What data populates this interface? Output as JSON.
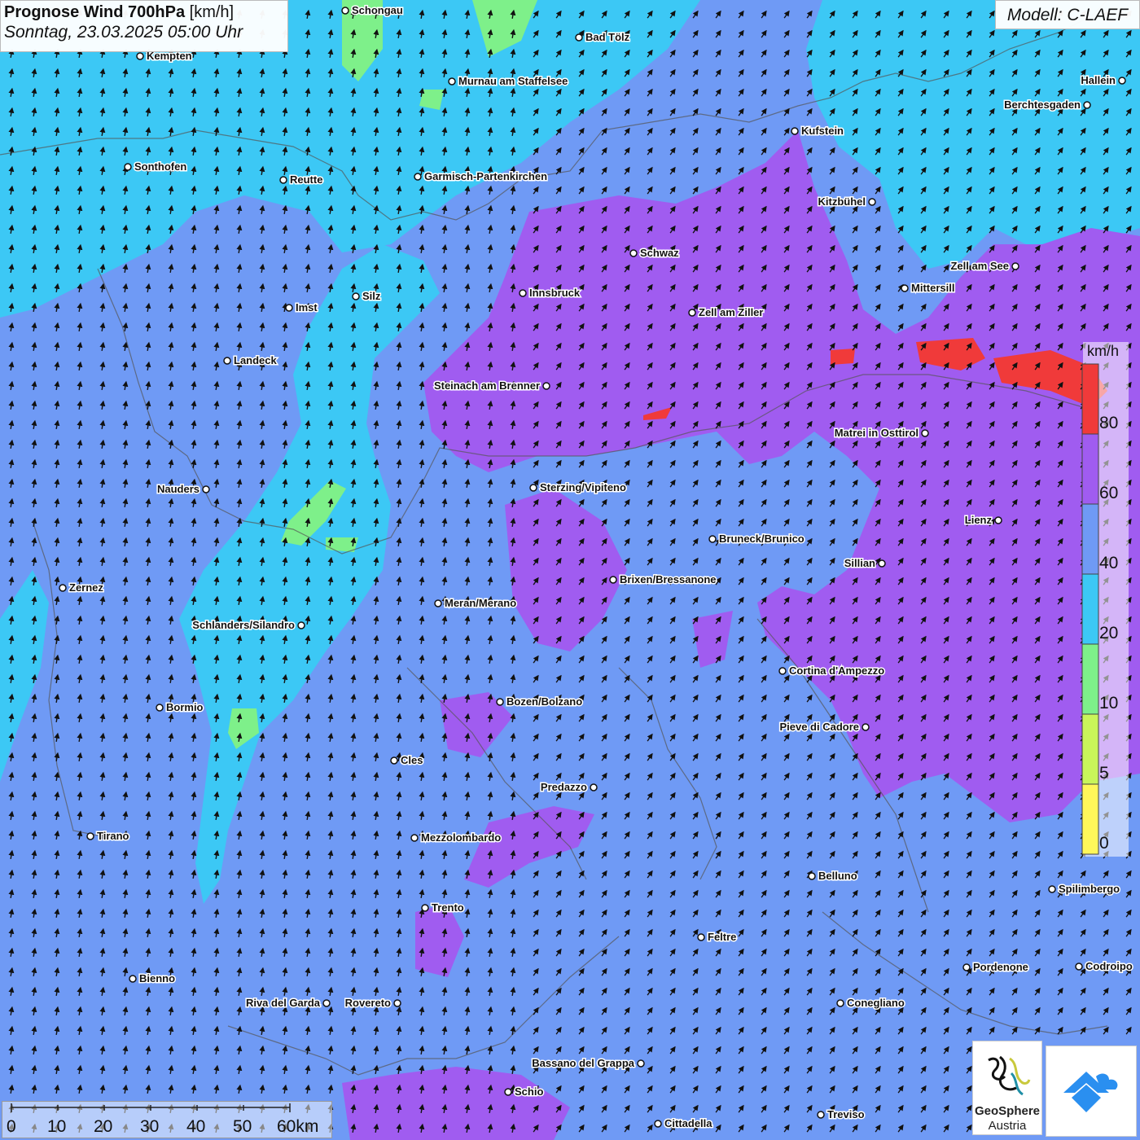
{
  "title": {
    "main": "Prognose Wind 700hPa",
    "unit": "[km/h]",
    "datetime": "Sonntag, 23.03.2025 05:00 Uhr"
  },
  "model": "Modell: C-LAEF",
  "legend": {
    "unit": "km/h",
    "labels": [
      "80",
      "60",
      "40",
      "20",
      "10",
      "5",
      "0"
    ],
    "colors": [
      "#f03a3a",
      "#a05cf0",
      "#6f9af5",
      "#3cc8f5",
      "#7ef08a",
      "#c9f55a",
      "#fff75a"
    ]
  },
  "scale_bar": {
    "labels": [
      "0",
      "10",
      "20",
      "30",
      "40",
      "50",
      "60km"
    ]
  },
  "logos": {
    "geosphere_name": "GeoSphere",
    "geosphere_sub": "Austria",
    "app_icon": "wind-app-icon",
    "geosphere_icon": "geosphere-logo-icon"
  },
  "map_colors": {
    "base": "#6f9af5",
    "cyan": "#3cc8f5",
    "purple": "#a05cf0",
    "green": "#7ef08a",
    "red": "#f03a3a"
  },
  "wind_direction": "from southwest / south",
  "cities": [
    {
      "name": "Schongau"
    },
    {
      "name": "Bad Tölz"
    },
    {
      "name": "Kempten"
    },
    {
      "name": "Murnau am Staffelsee"
    },
    {
      "name": "Hallein"
    },
    {
      "name": "Berchtesgaden"
    },
    {
      "name": "Kufstein"
    },
    {
      "name": "Sonthofen"
    },
    {
      "name": "Reutte"
    },
    {
      "name": "Garmisch-Partenkirchen"
    },
    {
      "name": "Kitzbühel"
    },
    {
      "name": "Schwaz"
    },
    {
      "name": "Zell am See"
    },
    {
      "name": "Mittersill"
    },
    {
      "name": "Innsbruck"
    },
    {
      "name": "Silz"
    },
    {
      "name": "Imst"
    },
    {
      "name": "Zell am Ziller"
    },
    {
      "name": "Landeck"
    },
    {
      "name": "Steinach am Brenner"
    },
    {
      "name": "Matrei in Osttirol"
    },
    {
      "name": "Nauders"
    },
    {
      "name": "Sterzing/Vipiteno"
    },
    {
      "name": "Lienz"
    },
    {
      "name": "Bruneck/Brunico"
    },
    {
      "name": "Sillian"
    },
    {
      "name": "Brixen/Bressanone"
    },
    {
      "name": "Zernez"
    },
    {
      "name": "Meran/Merano"
    },
    {
      "name": "Schlanders/Silandro"
    },
    {
      "name": "Cortina d'Ampezzo"
    },
    {
      "name": "Bozen/Bolzano"
    },
    {
      "name": "Bormio"
    },
    {
      "name": "Pieve di Cadore"
    },
    {
      "name": "Cles"
    },
    {
      "name": "Predazzo"
    },
    {
      "name": "Tirano"
    },
    {
      "name": "Mezzolombardo"
    },
    {
      "name": "Belluno"
    },
    {
      "name": "Spilimbergo"
    },
    {
      "name": "Trento"
    },
    {
      "name": "Feltre"
    },
    {
      "name": "Pordenone"
    },
    {
      "name": "Codroipo"
    },
    {
      "name": "Bienno"
    },
    {
      "name": "Riva del Garda"
    },
    {
      "name": "Rovereto"
    },
    {
      "name": "Conegliano"
    },
    {
      "name": "Bassano del Grappa"
    },
    {
      "name": "Schio"
    },
    {
      "name": "Treviso"
    },
    {
      "name": "Cittadella"
    }
  ]
}
